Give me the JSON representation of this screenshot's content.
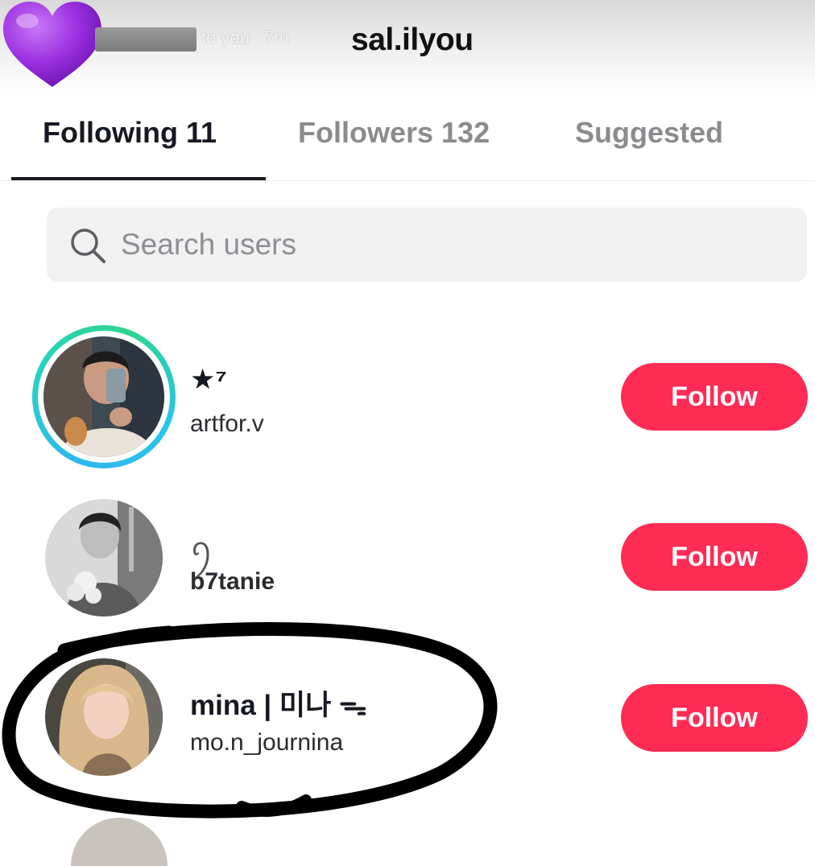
{
  "story": {
    "sent_to_text": "to you",
    "time_ago": "7m"
  },
  "header": {
    "title": "sal.ilyou"
  },
  "tabs": [
    {
      "label": "Following 11",
      "active": true
    },
    {
      "label": "Followers 132",
      "active": false
    },
    {
      "label": "Suggested",
      "active": false
    }
  ],
  "search": {
    "placeholder": "Search users",
    "value": ""
  },
  "users": [
    {
      "nickname": "★⁷",
      "username": "artfor.v",
      "button_label": "Follow",
      "has_story_ring": true
    },
    {
      "nickname": "ꪆ",
      "username": "b7tanie",
      "button_label": "Follow",
      "has_story_ring": false
    },
    {
      "nickname": "mina | 미나 ᯓ",
      "username": "mo.n_journina",
      "button_label": "Follow",
      "has_story_ring": false
    }
  ],
  "colors": {
    "accent": "#fe2c55",
    "text_primary": "#161823",
    "text_secondary": "#8a8b91",
    "search_bg": "#f1f1f2",
    "story_ring": "#2fb6f0",
    "heart": "#9b30e0"
  },
  "icons": {
    "sticker": "purple-heart-icon",
    "search": "search-icon"
  }
}
